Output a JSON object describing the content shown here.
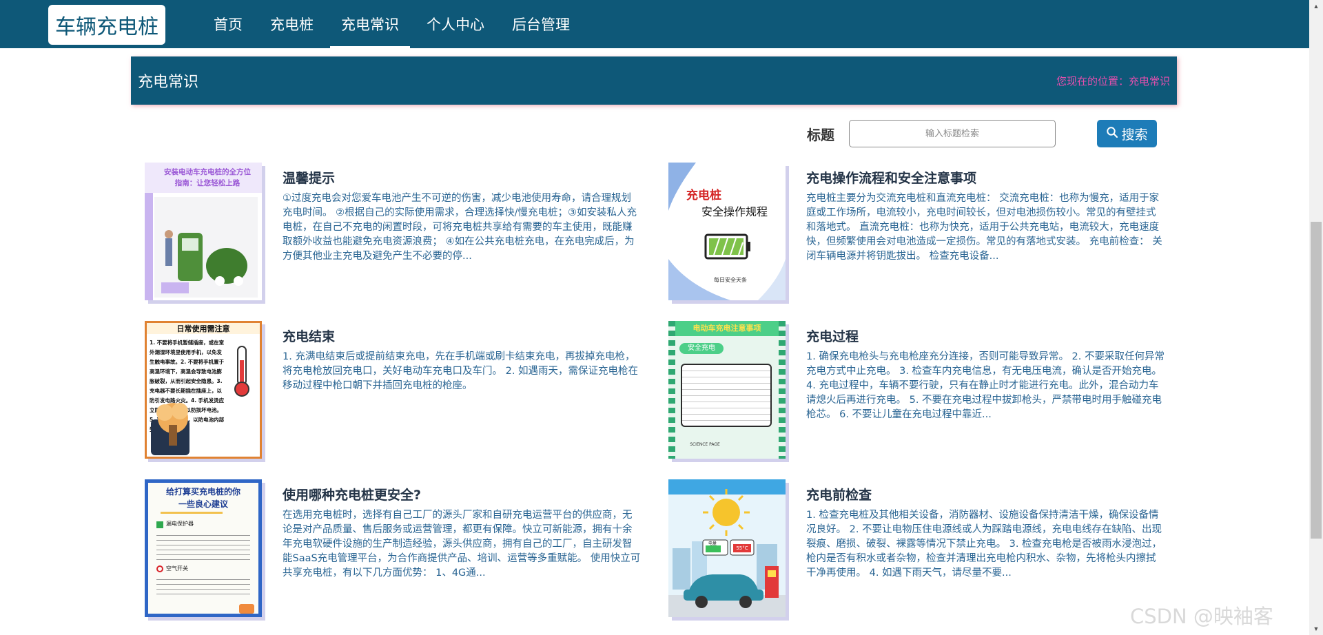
{
  "nav": {
    "brand": "车辆充电桩",
    "items": [
      {
        "label": "首页"
      },
      {
        "label": "充电桩"
      },
      {
        "label": "充电常识",
        "active": true
      },
      {
        "label": "个人中心"
      },
      {
        "label": "后台管理"
      }
    ]
  },
  "section": {
    "title": "充电常识",
    "breadcrumb": "您现在的位置：充电常识"
  },
  "search": {
    "label": "标题",
    "placeholder": "输入标题检索",
    "button": "搜索"
  },
  "articles": [
    {
      "title": "温馨提示",
      "desc": "①过度充电会对您爱车电池产生不可逆的伤害，减少电池使用寿命，请合理规划充电时间。 ②根据自己的实际使用需求，合理选择快/慢充电桩；③如安装私人充电桩，在自己不充电的闲置时段，可将充电桩共享给有需要的车主使用，既能赚取额外收益也能避免充电资源浪费； ④如在公共充电桩充电，在充电完成后，为方便其他业主充电及避免产生不必要的停...",
      "thumb": {
        "line1": "安装电动车充电桩的全方位",
        "line2": "指南：让您轻松上路"
      }
    },
    {
      "title": "充电操作流程和安全注意事项",
      "desc": "充电桩主要分为交流充电桩和直流充电桩： 交流充电桩：也称为慢充，适用于家庭或工作场所，电流较小，充电时间较长，但对电池损伤较小。常见的有壁挂式和落地式。 直流充电桩：也称为快充，适用于公共充电站，电流较大，充电速度快，但频繁使用会对电池造成一定损伤。常见的有落地式安装。 充电前检查： 关闭车辆电源并将钥匙拔出。 检查充电设备...",
      "thumb": {
        "line1": "充电桩",
        "line2": "安全操作规程",
        "line3": "每日安全天条"
      }
    },
    {
      "title": "充电结束",
      "desc": "1. 充满电结束后或提前结束充电，先在手机端或刷卡结束充电，再拔掉充电枪，将充电枪放回充电口，关好电动车充电口及车门。 2. 如遇雨天，需保证充电枪在移动过程中枪口朝下并插回充电桩的枪座。",
      "thumb": {
        "line1": "日常使用需注意",
        "body": "1. 不要将手机暂储插座，或在室外潮湿环境里使用手机，以免发生触电事故。2. 不要将手机置于高温环境下，高温会导致电池膨胀破裂，从而引起安全隐患。3. 充电器不要长期插在插座上，以防引发电路火灾。4. 手机发烫应立即停止使用，以防损坏电池。5. 减少手机磕碰，以防电池内部受损。"
      }
    },
    {
      "title": "充电过程",
      "desc": "1. 确保充电枪头与充电枪座充分连接，否则可能导致异常。 2. 不要采取任何异常充电方式中止充电。 3. 检查车内充电信息，有无电压电流，确认是否开始充电。 4. 充电过程中，车辆不要行驶，只有在静止时才能进行充电。此外，混合动力车请熄火后再进行充电。 5. 不要在充电过程中拔卸枪头，严禁带电时用手触碰充电枪芯。 6. 不要让儿童在充电过程中靠近...",
      "thumb": {
        "line1": "电动车充电注意事项",
        "line2": "安全充电",
        "line3": "SCIENCE PAGE"
      }
    },
    {
      "title": "使用哪种充电桩更安全?",
      "desc": "在选用充电桩时，选择有自己工厂的源头厂家和自研充电运营平台的供应商，无论是对产品质量、售后服务或运营管理，都更有保障。快立可新能源，拥有十余年充电软硬件设施的生产制造经验，源头供应商，拥有自己的工厂，自主研发智能SaaS充电管理平台，为合作商提供产品、培训、运营等多重赋能。 使用快立可共享充电桩，有以下几方面优势： 1、4G通...",
      "thumb": {
        "line1": "给打算买充电桩的你",
        "line2": "一些良心建议",
        "item1": "漏电保护器",
        "item2": "空气开关"
      }
    },
    {
      "title": "充电前检查",
      "desc": "1. 检查充电桩及其他相关设备，消防器材、设施设备保持清洁干燥，确保设备情况良好。 2. 不要让电物压住电源线或人为踩踏电源线，充电电线存在缺陷、出现裂痕、磨损、破裂、裸露等情况下禁止充电。 3. 检查充电枪是否被雨水浸泡过，枪内是否有积水或者杂物，检查并清理出充电枪内积水、杂物，先将枪头内擦拭干净再使用。 4. 如遇下雨天气，请尽量不要...",
      "thumb": {
        "line1": "电量",
        "line2": "55°C"
      }
    }
  ],
  "scrollbar": {
    "position": 0.36
  },
  "watermark": "CSDN @映袖客",
  "colors": {
    "primary": "#0e5878",
    "button": "#1d7cb8",
    "breadcrumb": "#e64fae",
    "desc": "#2a6593"
  }
}
